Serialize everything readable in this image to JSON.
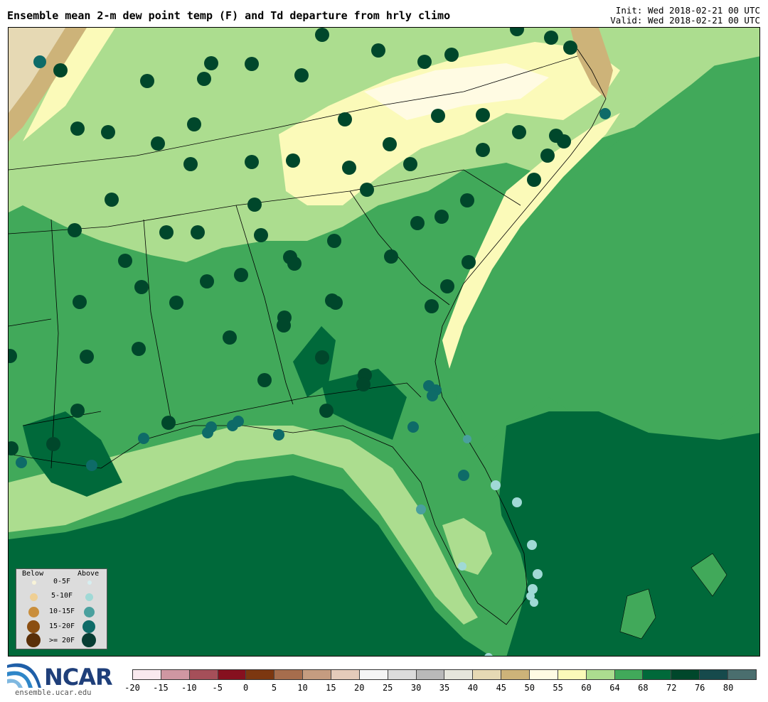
{
  "header": {
    "title": "Ensemble mean 2-m dew point temp (F) and Td departure from hrly climo",
    "init": "Init: Wed 2018-02-21 00 UTC",
    "valid": "Valid: Wed 2018-02-21 00 UTC"
  },
  "legend": {
    "below_label": "Below",
    "above_label": "Above",
    "rows": [
      {
        "label": "0-5F",
        "below_color": "#f8f3d8",
        "above_color": "#d6eef0"
      },
      {
        "label": "5-10F",
        "below_color": "#efcf94",
        "above_color": "#a0d9d6"
      },
      {
        "label": "10-15F",
        "below_color": "#c98e3c",
        "above_color": "#4aa09e"
      },
      {
        "label": "15-20F",
        "below_color": "#8b4f12",
        "above_color": "#0e6b68"
      },
      {
        "label": ">= 20F",
        "below_color": "#5a2f08",
        "above_color": "#083d33"
      }
    ]
  },
  "colorbar": {
    "ticks": [
      "-20",
      "-15",
      "-10",
      "-5",
      "0",
      "5",
      "10",
      "15",
      "20",
      "25",
      "30",
      "35",
      "40",
      "45",
      "50",
      "55",
      "60",
      "64",
      "68",
      "72",
      "76",
      "80"
    ],
    "colors": [
      "#f9e9ee",
      "#cf97a2",
      "#a54f59",
      "#86101f",
      "#7c3710",
      "#a66d4d",
      "#c59c80",
      "#e4cbba",
      "#f5f5f5",
      "#dcdcdc",
      "#b9b9b9",
      "#e6e6dc",
      "#e6d9b4",
      "#cdb379",
      "#fffbe3",
      "#fbfab9",
      "#acdd8f",
      "#41a95a",
      "#00693a",
      "#00472b",
      "#164a4c",
      "#4a6e6e"
    ]
  },
  "logo": {
    "name": "NCAR",
    "url": "ensemble.ucar.edu"
  },
  "map_fill_colors": {
    "ocean_deep": "#00693a",
    "land_main": "#41a95a",
    "light_green": "#acdd8f",
    "pale_yellow": "#fbfab9",
    "cream": "#fffbe3",
    "tan": "#cdb379",
    "beige": "#e6d9b4",
    "station_big": "#00472b",
    "station_teal": "#0e6b68"
  }
}
